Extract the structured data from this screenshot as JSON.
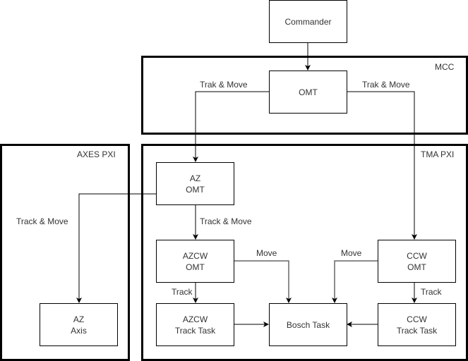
{
  "groups": {
    "mcc": "MCC",
    "tma_pxi": "TMA PXI",
    "axes_pxi": "AXES PXI"
  },
  "nodes": {
    "commander": "Commander",
    "omt": "OMT",
    "az_omt": "AZ\nOMT",
    "azcw_omt": "AZCW\nOMT",
    "azcw_track_task": "AZCW\nTrack Task",
    "bosch_task": "Bosch Task",
    "ccw_omt": "CCW\nOMT",
    "ccw_track_task": "CCW\nTrack Task",
    "az_axis": "AZ\nAxis"
  },
  "edges": {
    "omt_to_az_omt": "Trak & Move",
    "omt_to_ccw_omt": "Trak & Move",
    "az_omt_to_az_axis": "Track & Move",
    "az_omt_to_azcw_omt": "Track & Move",
    "azcw_omt_to_bosch": "Move",
    "ccw_omt_to_bosch": "Move",
    "azcw_omt_to_azcw_track": "Track",
    "ccw_omt_to_ccw_track": "Track"
  }
}
